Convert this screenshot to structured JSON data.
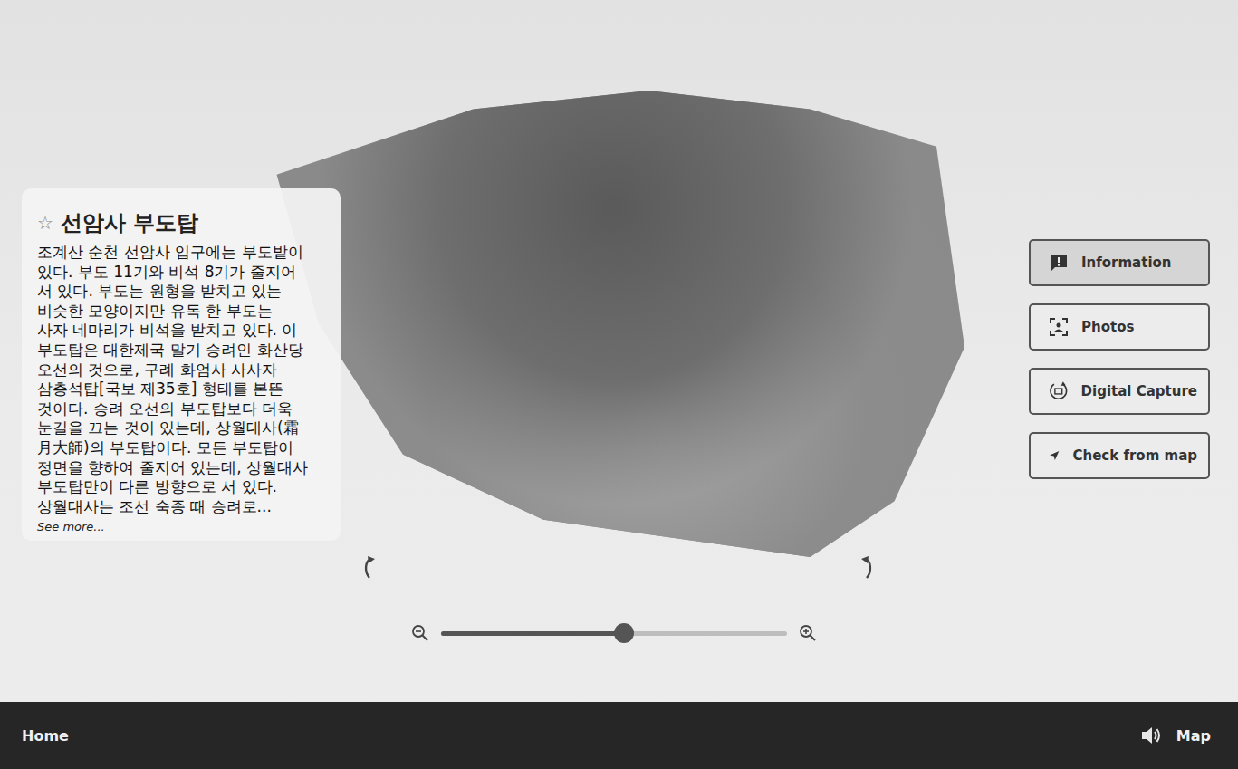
{
  "info": {
    "star": "☆",
    "favorite": false,
    "title": "선암사 부도탑",
    "lines": [
      "조계산 순천 선암사 입구에는 부도밭이",
      "있다. 부도 11기와 비석 8기가 줄지어",
      "서 있다. 부도는 원형을 받치고 있는",
      "비슷한 모양이지만 유독 한 부도는",
      "사자 네마리가 비석을 받치고 있다. 이",
      "부도탑은 대한제국 말기 승려인 화산당",
      "오선의 것으로, 구례 화엄사 사사자",
      "삼층석탑[국보 제35호] 형태를 본뜬",
      "것이다. 승려 오선의 부도탑보다 더욱",
      "눈길을 끄는 것이 있는데, 상월대사(霜",
      "月大師)의 부도탑이다. 모든 부도탑이",
      "정면을 향하여 줄지어 있는데, 상월대사",
      "부도탑만이 다른 방향으로 서 있다.",
      "상월대사는 조선 숙종 때 승려로..."
    ],
    "see_more": "See more..."
  },
  "viewer": {
    "zoom_level": 0.53
  },
  "menu": [
    {
      "label": "Information",
      "kind": "information",
      "selected": true
    },
    {
      "label": "Photos",
      "kind": "photos",
      "selected": false
    },
    {
      "label": "Digital Capture",
      "kind": "capture",
      "selected": false
    },
    {
      "label": "Check from map",
      "kind": "map",
      "selected": false
    }
  ],
  "bottom_bar": {
    "home": "Home",
    "map": "Map"
  }
}
